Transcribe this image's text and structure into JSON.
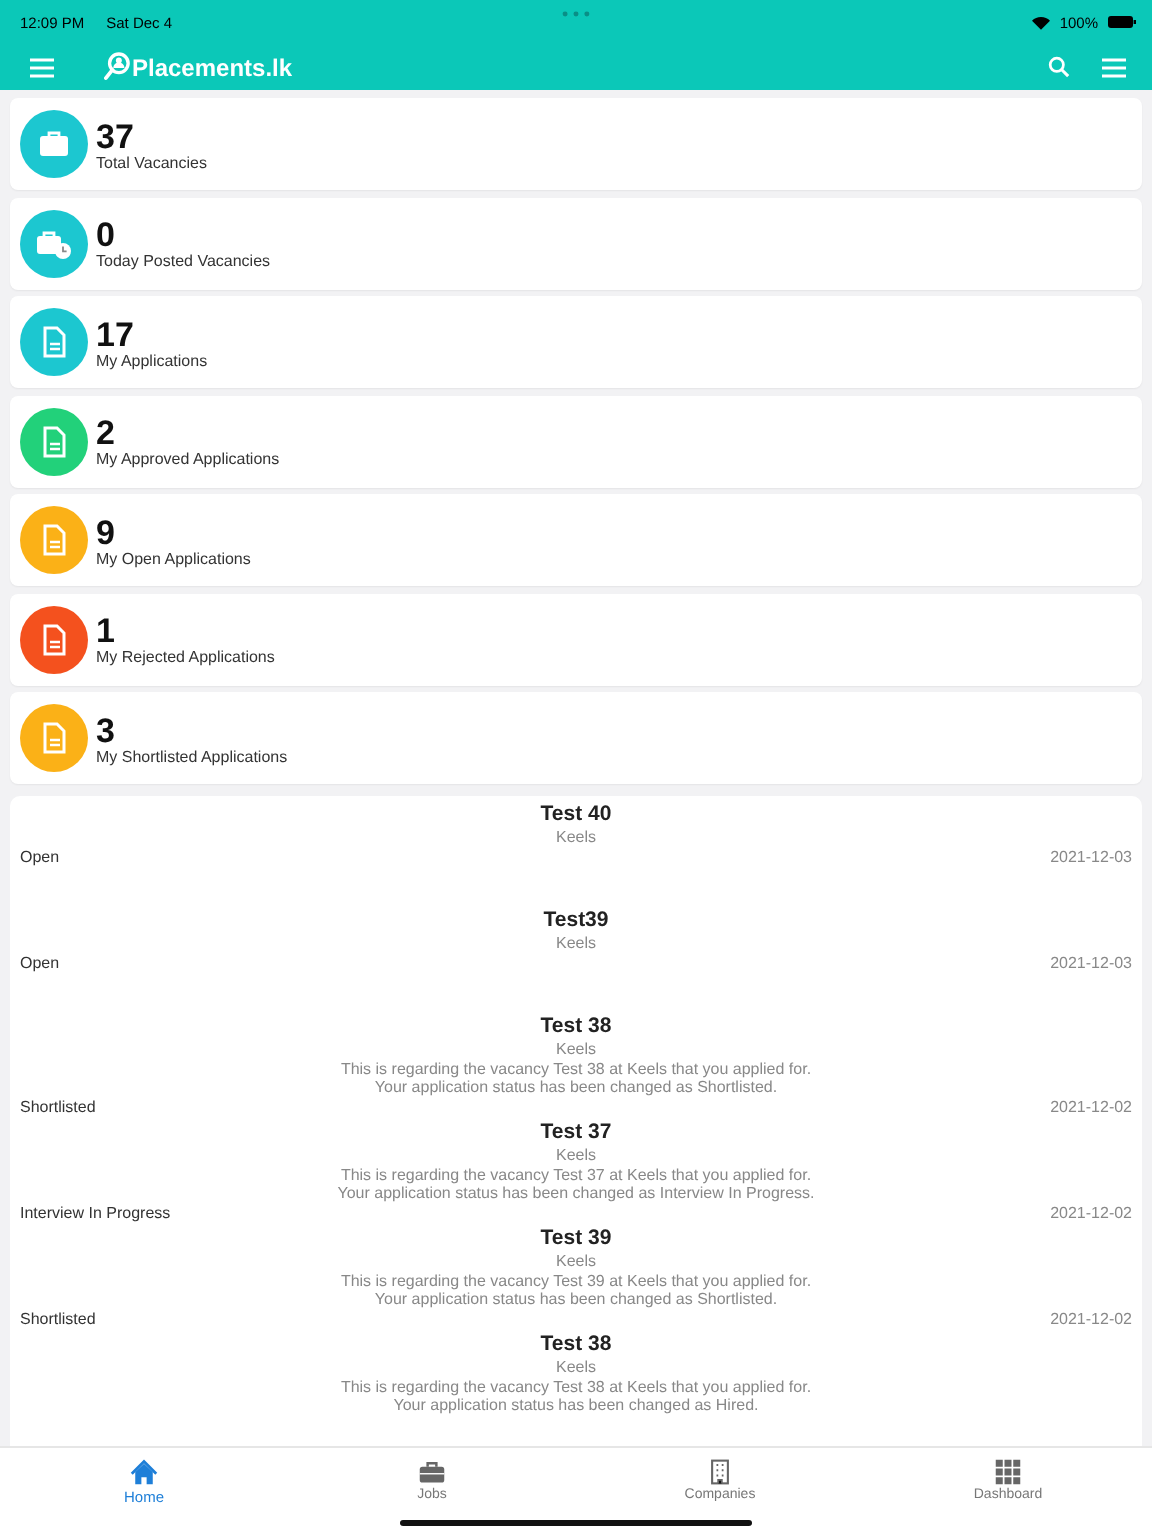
{
  "status_bar": {
    "time": "12:09 PM",
    "date": "Sat Dec 4",
    "battery": "100%"
  },
  "app_bar": {
    "title": "Placements.lk"
  },
  "stats": [
    {
      "value": "37",
      "label": "Total Vacancies",
      "kind": "briefcase",
      "color": "#1cc7d0"
    },
    {
      "value": "0",
      "label": "Today Posted Vacancies",
      "kind": "briefcase-clock",
      "color": "#1cc7d0"
    },
    {
      "value": "17",
      "label": "My Applications",
      "kind": "document",
      "color": "#1cc7d0"
    },
    {
      "value": "2",
      "label": "My Approved Applications",
      "kind": "document",
      "color": "#22d17a"
    },
    {
      "value": "9",
      "label": "My Open Applications",
      "kind": "document",
      "color": "#fbb117"
    },
    {
      "value": "1",
      "label": "My Rejected Applications",
      "kind": "document",
      "color": "#f4511e"
    },
    {
      "value": "3",
      "label": "My Shortlisted Applications",
      "kind": "document",
      "color": "#fbb117"
    }
  ],
  "notifications": [
    {
      "title": "Test 40",
      "company": "Keels",
      "status": "Open",
      "date": "2021-12-03"
    },
    {
      "title": "Test39",
      "company": "Keels",
      "status": "Open",
      "date": "2021-12-03"
    },
    {
      "title": "Test 38",
      "company": "Keels",
      "message": [
        "This is regarding the vacancy Test 38 at Keels that you applied for.",
        "Your application status has been changed as Shortlisted."
      ],
      "status": "Shortlisted",
      "date": "2021-12-02"
    },
    {
      "title": "Test 37",
      "company": "Keels",
      "message": [
        "This is regarding the vacancy Test 37 at Keels that you applied for.",
        "Your application status has been changed as Interview In Progress."
      ],
      "status": "Interview In Progress",
      "date": "2021-12-02"
    },
    {
      "title": "Test 39",
      "company": "Keels",
      "message": [
        "This is regarding the vacancy Test 39 at Keels that you applied for.",
        "Your application status has been changed as Shortlisted."
      ],
      "status": "Shortlisted",
      "date": "2021-12-02"
    },
    {
      "title": "Test 38",
      "company": "Keels",
      "message": [
        "This is regarding the vacancy Test 38 at Keels that you applied for.",
        "Your application status has been changed as Hired."
      ]
    }
  ],
  "tabs": [
    {
      "label": "Home",
      "kind": "home",
      "selected": true
    },
    {
      "label": "Jobs",
      "kind": "jobs",
      "selected": false
    },
    {
      "label": "Companies",
      "kind": "companies",
      "selected": false
    },
    {
      "label": "Dashboard",
      "kind": "dashboard",
      "selected": false
    }
  ]
}
